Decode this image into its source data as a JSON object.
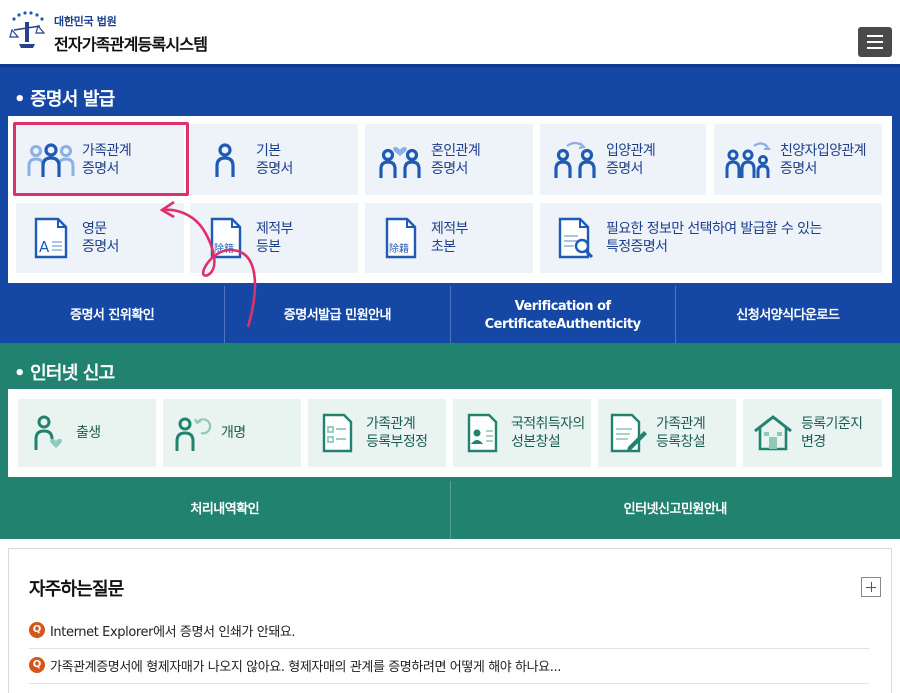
{
  "header": {
    "org": "대한민국 법원",
    "system": "전자가족관계등록시스템"
  },
  "cert": {
    "title": "• 증명서 발급",
    "row1": [
      {
        "l1": "가족관계",
        "l2": "증명서"
      },
      {
        "l1": "기본",
        "l2": "증명서"
      },
      {
        "l1": "혼인관계",
        "l2": "증명서"
      },
      {
        "l1": "입양관계",
        "l2": "증명서"
      },
      {
        "l1": "친양자입양관계",
        "l2": "증명서"
      }
    ],
    "row2": [
      {
        "l1": "영문",
        "l2": "증명서"
      },
      {
        "l1": "제적부",
        "l2": "등본"
      },
      {
        "l1": "제적부",
        "l2": "초본"
      },
      {
        "l1": "필요한 정보만 선택하여 발급할 수 있는",
        "l2": "특정증명서"
      }
    ],
    "joseki_glyph": "除籍",
    "links": [
      {
        "l1": "증명서 진위확인",
        "l2": ""
      },
      {
        "l1": "증명서발급 민원안내",
        "l2": ""
      },
      {
        "l1": "Verification of",
        "l2": "CertificateAuthenticity"
      },
      {
        "l1": "신청서양식다운로드",
        "l2": ""
      }
    ]
  },
  "report": {
    "title": "• 인터넷 신고",
    "tiles": [
      {
        "l1": "출생",
        "l2": ""
      },
      {
        "l1": "개명",
        "l2": ""
      },
      {
        "l1": "가족관계",
        "l2": "등록부정정"
      },
      {
        "l1": "국적취득자의",
        "l2": "성본창설"
      },
      {
        "l1": "가족관계",
        "l2": "등록창설"
      },
      {
        "l1": "등록기준지",
        "l2": "변경"
      }
    ],
    "links": [
      {
        "l1": "처리내역확인"
      },
      {
        "l1": "인터넷신고민원안내"
      }
    ]
  },
  "faq": {
    "title": "자주하는질문",
    "q_badge": "Q",
    "items": [
      "Internet Explorer에서 증명서 인쇄가 안돼요.",
      "가족관계증명서에 형제자매가 나오지 않아요. 형제자매의 관계를 증명하려면 어떻게 해야 하나요..."
    ]
  },
  "colors": {
    "cert_bg": "#1548a5",
    "report_bg": "#21826f",
    "icon_blue": "#1f5bb5",
    "icon_light": "#8cb0e3",
    "highlight": "#e0306b",
    "q_badge": "#d4571a"
  }
}
